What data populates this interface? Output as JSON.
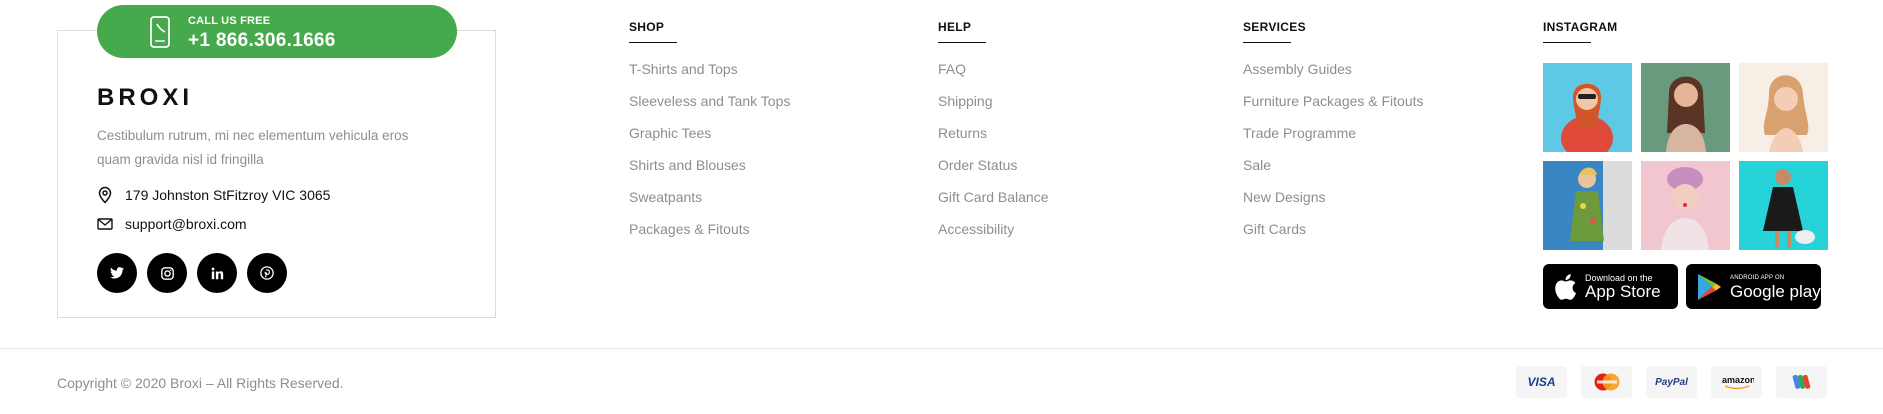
{
  "contact": {
    "call_label": "CALL US FREE",
    "phone": "+1 866.306.1666",
    "brand": "BROXI",
    "description": "Cestibulum rutrum, mi nec elementum vehicula eros quam gravida nisl id fringilla",
    "address": "179 Johnston StFitzroy VIC 3065",
    "email": "support@broxi.com",
    "socials": [
      "twitter-icon",
      "instagram-icon",
      "linkedin-icon",
      "pinterest-icon"
    ]
  },
  "shop": {
    "title": "SHOP",
    "links": [
      "T-Shirts and Tops",
      "Sleeveless and Tank Tops",
      "Graphic Tees",
      "Shirts and Blouses",
      "Sweatpants",
      "Packages & Fitouts"
    ]
  },
  "help": {
    "title": "HELP",
    "links": [
      "FAQ",
      "Shipping",
      "Returns",
      "Order Status",
      "Gift Card Balance",
      "Accessibility"
    ]
  },
  "services": {
    "title": "SERVICES",
    "links": [
      "Assembly Guides",
      "Furniture Packages & Fitouts",
      "Trade Programme",
      "Sale",
      "New Designs",
      "Gift Cards"
    ]
  },
  "instagram": {
    "title": "INSTAGRAM",
    "tiles": [
      {
        "bg": "#5ec9e4",
        "accent": "#e04a3a"
      },
      {
        "bg": "#6a9a7d",
        "accent": "#d8b5a0"
      },
      {
        "bg": "#f7efe6",
        "accent": "#d9a16f"
      },
      {
        "bg": "#3a86c2",
        "accent": "#6d9a3a"
      },
      {
        "bg": "#f2c6cf",
        "accent": "#f0e2e5"
      },
      {
        "bg": "#26d3d8",
        "accent": "#1a1a1a"
      }
    ],
    "appstore_top": "Download on the",
    "appstore_bottom": "App Store",
    "googleplay_top": "ANDROID APP ON",
    "googleplay_bottom": "Google play"
  },
  "footer": {
    "copyright": "Copyright © 2020 Broxi – All Rights Reserved.",
    "payments": [
      "VISA",
      "mastercard",
      "PayPal",
      "amazon",
      "google-wallet"
    ]
  },
  "colors": {
    "accent_green": "#46a94c",
    "link_gray": "#8e8e8e",
    "border": "#dcdcdc"
  }
}
